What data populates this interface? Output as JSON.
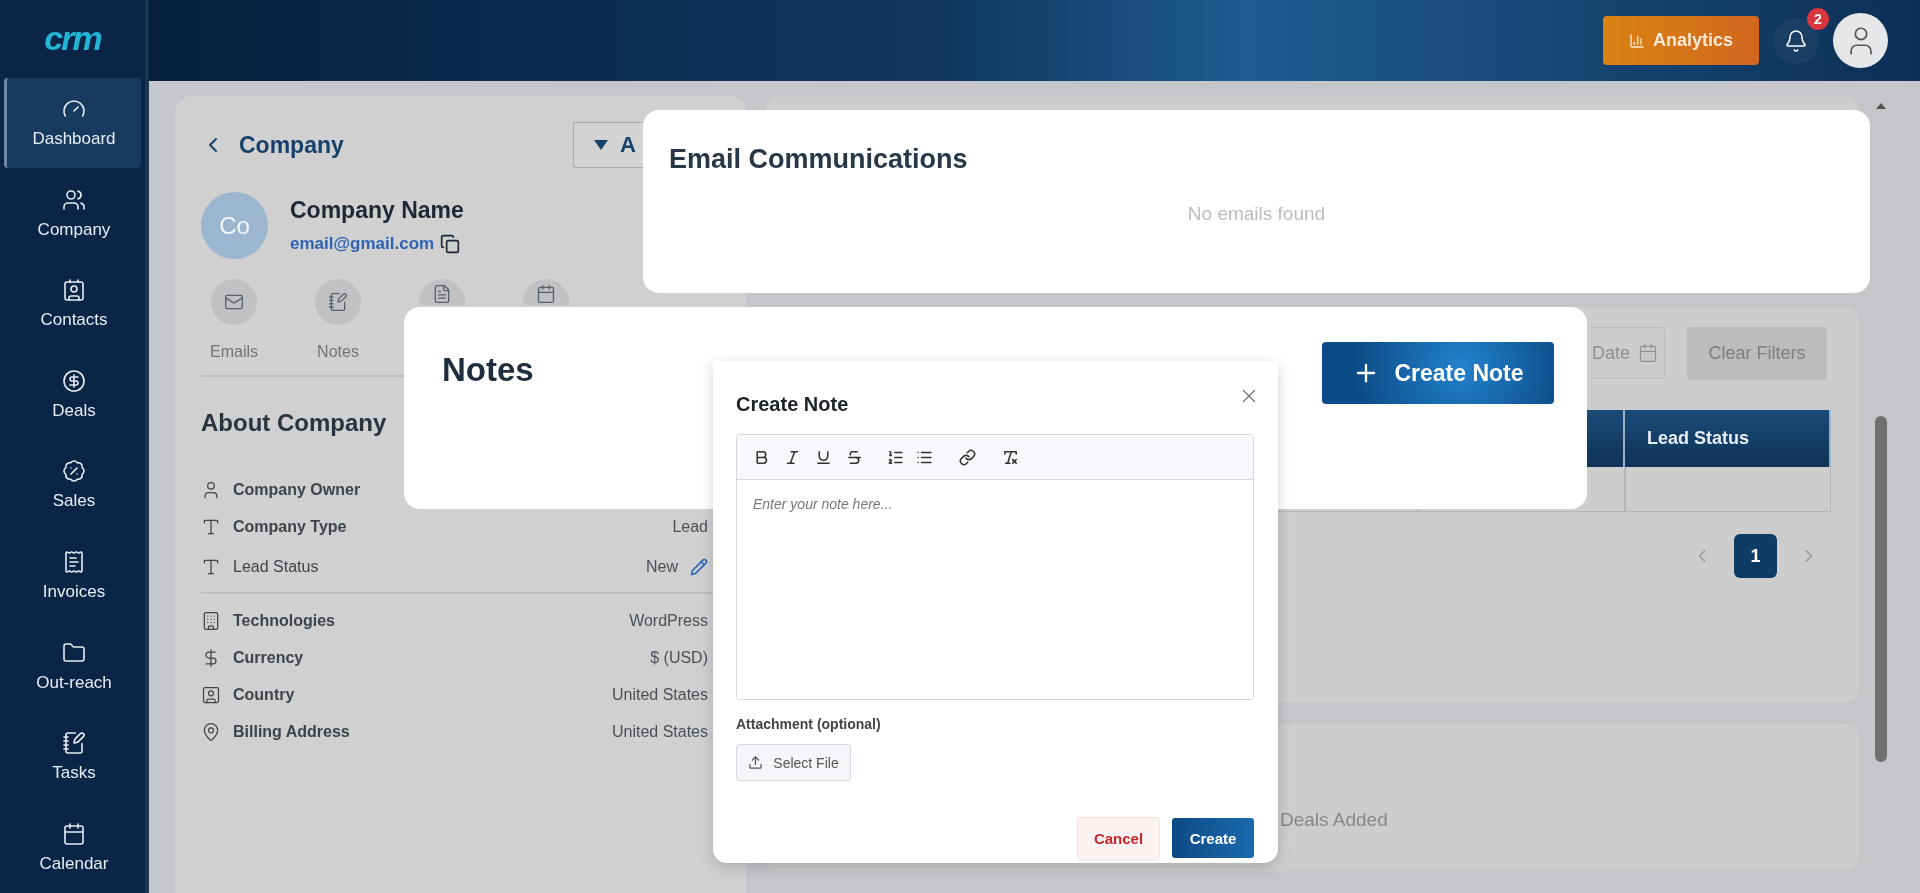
{
  "sidebar": {
    "logo": "crm",
    "items": [
      {
        "label": "Dashboard",
        "selected": true
      },
      {
        "label": "Company",
        "selected": false
      },
      {
        "label": "Contacts",
        "selected": false
      },
      {
        "label": "Deals",
        "selected": false
      },
      {
        "label": "Sales",
        "selected": false
      },
      {
        "label": "Invoices",
        "selected": false
      },
      {
        "label": "Out-reach",
        "selected": false
      },
      {
        "label": "Tasks",
        "selected": false
      },
      {
        "label": "Calendar",
        "selected": false
      }
    ]
  },
  "header": {
    "analytics_button": "Analytics",
    "notification_count": "2"
  },
  "company": {
    "back_label": "Company",
    "actions_button": "A",
    "avatar_initials": "Co",
    "name": "Company Name",
    "email": "email@gmail.com",
    "quick_actions": [
      "Emails",
      "Notes"
    ],
    "about_title": "About Company",
    "fields": [
      {
        "label": "Company Owner",
        "editable": false
      },
      {
        "label": "Company Type",
        "value": "Lead",
        "editable": false
      },
      {
        "label": "Lead Status",
        "value": "New",
        "editable": true
      }
    ],
    "details": [
      {
        "label": "Technologies",
        "value": "WordPress"
      },
      {
        "label": "Currency",
        "value": "$ (USD)"
      },
      {
        "label": "Country",
        "value": "United States"
      },
      {
        "label": "Billing Address",
        "value": "United States"
      }
    ]
  },
  "contacts_table": {
    "date_placeholder": "Date",
    "clear_filters": "Clear Filters",
    "columns": [
      {
        "label": "Lead Status"
      }
    ],
    "pages": [
      {
        "label": "1",
        "selected": true
      }
    ]
  },
  "deals": {
    "empty_text": "Deals Added"
  },
  "email_card": {
    "title": "Email Communications",
    "empty_text": "No emails found"
  },
  "notes_card": {
    "title": "Notes",
    "create_button": "Create Note"
  },
  "create_note_modal": {
    "title": "Create Note",
    "placeholder": "Enter your note here...",
    "attachment_label": "Attachment (optional)",
    "select_file": "Select File",
    "cancel": "Cancel",
    "create": "Create"
  }
}
